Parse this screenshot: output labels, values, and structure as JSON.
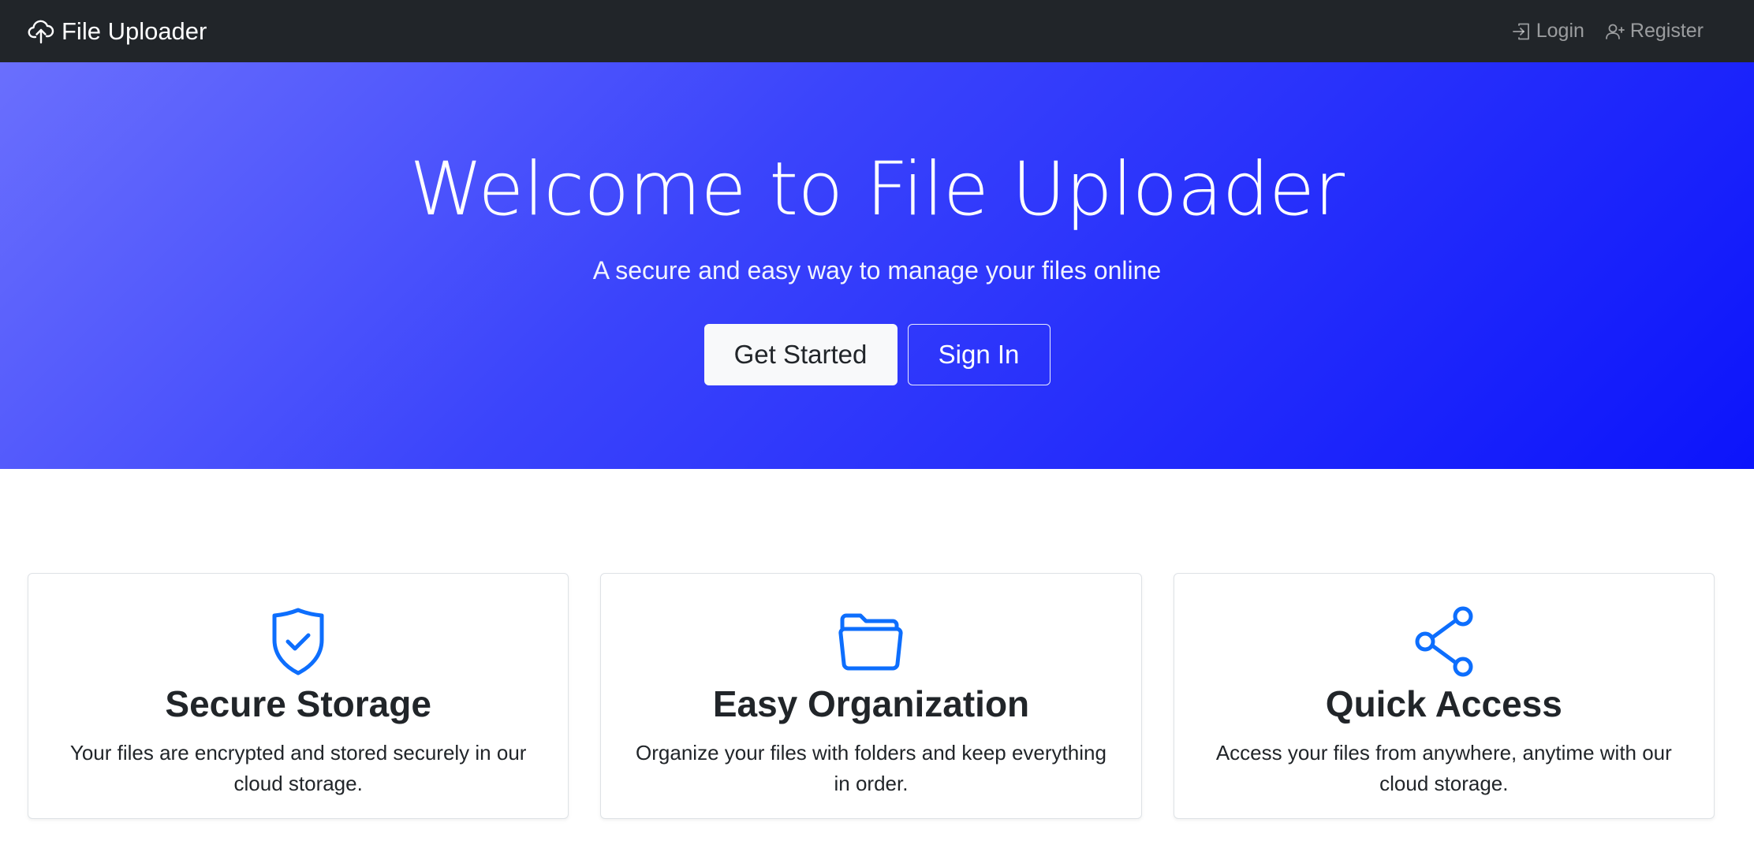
{
  "navbar": {
    "brand": "File Uploader",
    "brand_icon": "cloud-upload-icon",
    "links": [
      {
        "label": "Login",
        "icon": "login-icon"
      },
      {
        "label": "Register",
        "icon": "person-plus-icon"
      }
    ]
  },
  "hero": {
    "title": "Welcome to File Uploader",
    "subtitle": "A secure and easy way to manage your files online",
    "primary_button": "Get Started",
    "secondary_button": "Sign In"
  },
  "features": [
    {
      "icon": "shield-check-icon",
      "title": "Secure Storage",
      "text": "Your files are encrypted and stored securely in our cloud storage."
    },
    {
      "icon": "folder-icon",
      "title": "Easy Organization",
      "text": "Organize your files with folders and keep everything in order."
    },
    {
      "icon": "share-icon",
      "title": "Quick Access",
      "text": "Access your files from anywhere, anytime with our cloud storage."
    }
  ],
  "colors": {
    "navbar_bg": "#212529",
    "hero_gradient_start": "#6a6ffd",
    "hero_gradient_end": "#0c14fb",
    "icon_accent": "#0d6efd"
  }
}
